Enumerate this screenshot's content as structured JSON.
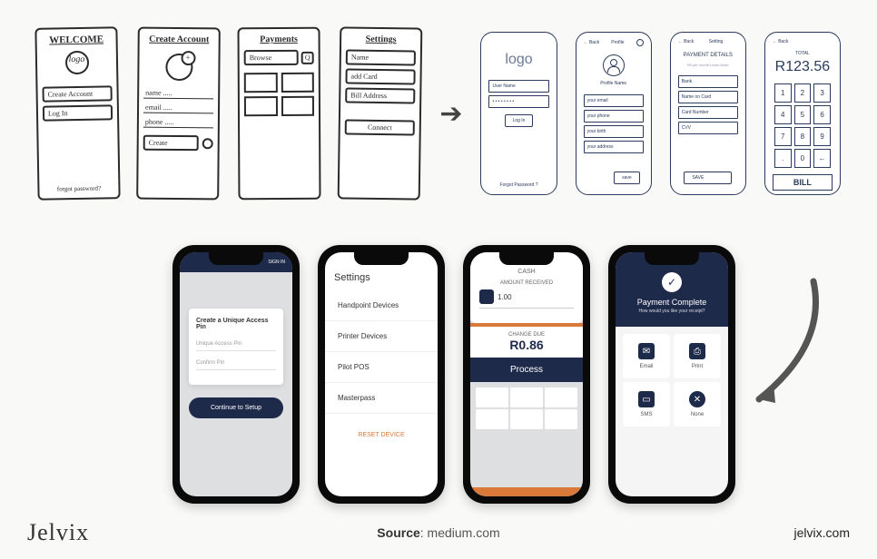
{
  "sketch": {
    "welcome": {
      "title": "WELCOME",
      "logo": "logo",
      "createAccount": "Create Account",
      "login": "Log In",
      "forgot": "forgot password?"
    },
    "create": {
      "title": "Create Account",
      "name": "name .....",
      "email": "email .....",
      "phone": "phone .....",
      "createBtn": "Create"
    },
    "payments": {
      "title": "Payments",
      "browse": "Browse",
      "q": "Q"
    },
    "settings": {
      "title": "Settings",
      "name": "Name",
      "addCard": "add Card",
      "billAddress": "Bill Address",
      "connect": "Connect"
    }
  },
  "wire": {
    "back": "← Back",
    "login": {
      "logo": "logo",
      "userName": "User Name",
      "password": "• • • • • • • •",
      "loginBtn": "Log In",
      "forgot": "Forgot Password ?"
    },
    "profile": {
      "title": "Profile",
      "name": "Profile Name",
      "email": "your email",
      "phone": "your phone",
      "birth": "your birth",
      "address": "your address",
      "save": "save"
    },
    "payment": {
      "title": "Setting",
      "section": "PAYMENT DETAILS",
      "sub": "R0 per month\nLearn More",
      "bank": "Bank",
      "nameOnCard": "Name on Card",
      "cardNumber": "Card Number",
      "cvv": "CVV",
      "saveBtn": "SAVE"
    },
    "keypad": {
      "total": "TOTAL",
      "amount": "R123.56",
      "keys": [
        "1",
        "2",
        "3",
        "4",
        "5",
        "6",
        "7",
        "8",
        "9",
        ".",
        "0",
        "←"
      ],
      "bill": "BILL"
    }
  },
  "hifi": {
    "pin": {
      "topRight": "SIGN IN",
      "title": "Create a Unique Access Pin",
      "field1": "Unique Access Pin",
      "field2": "Confirm Pin",
      "btn": "Continue to Setup"
    },
    "settings": {
      "title": "Settings",
      "items": [
        "Handpoint Devices",
        "Printer Devices",
        "Pilot POS",
        "Masterpass"
      ],
      "reset": "RESET DEVICE"
    },
    "cash": {
      "cash": "CASH",
      "amtLabel": "AMOUNT RECEIVED",
      "amt": "1.00",
      "changeLabel": "CHANGE DUE",
      "change": "R0.86",
      "process": "Process"
    },
    "complete": {
      "title": "Payment Complete",
      "sub": "How would you like your receipt?",
      "opts": [
        "Email",
        "Print",
        "SMS",
        "None"
      ]
    }
  },
  "footer": {
    "brand": "Jelvix",
    "sourceLabel": "Source",
    "sourceVal": ": medium.com",
    "site": "jelvix.com"
  }
}
